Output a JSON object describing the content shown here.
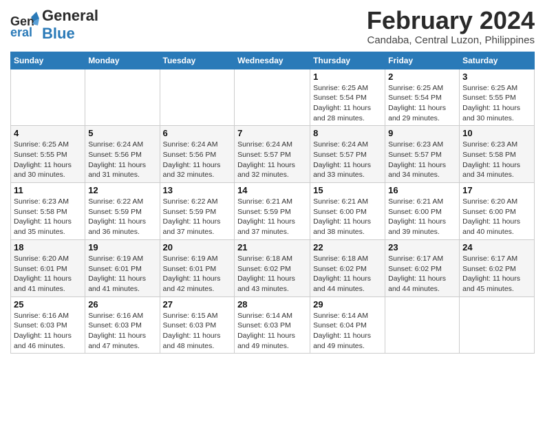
{
  "header": {
    "logo_general": "General",
    "logo_blue": "Blue",
    "month_title": "February 2024",
    "location": "Candaba, Central Luzon, Philippines"
  },
  "weekdays": [
    "Sunday",
    "Monday",
    "Tuesday",
    "Wednesday",
    "Thursday",
    "Friday",
    "Saturday"
  ],
  "weeks": [
    [
      {
        "num": "",
        "sunrise": "",
        "sunset": "",
        "daylight": ""
      },
      {
        "num": "",
        "sunrise": "",
        "sunset": "",
        "daylight": ""
      },
      {
        "num": "",
        "sunrise": "",
        "sunset": "",
        "daylight": ""
      },
      {
        "num": "",
        "sunrise": "",
        "sunset": "",
        "daylight": ""
      },
      {
        "num": "1",
        "sunrise": "Sunrise: 6:25 AM",
        "sunset": "Sunset: 5:54 PM",
        "daylight": "Daylight: 11 hours and 28 minutes."
      },
      {
        "num": "2",
        "sunrise": "Sunrise: 6:25 AM",
        "sunset": "Sunset: 5:54 PM",
        "daylight": "Daylight: 11 hours and 29 minutes."
      },
      {
        "num": "3",
        "sunrise": "Sunrise: 6:25 AM",
        "sunset": "Sunset: 5:55 PM",
        "daylight": "Daylight: 11 hours and 30 minutes."
      }
    ],
    [
      {
        "num": "4",
        "sunrise": "Sunrise: 6:25 AM",
        "sunset": "Sunset: 5:55 PM",
        "daylight": "Daylight: 11 hours and 30 minutes."
      },
      {
        "num": "5",
        "sunrise": "Sunrise: 6:24 AM",
        "sunset": "Sunset: 5:56 PM",
        "daylight": "Daylight: 11 hours and 31 minutes."
      },
      {
        "num": "6",
        "sunrise": "Sunrise: 6:24 AM",
        "sunset": "Sunset: 5:56 PM",
        "daylight": "Daylight: 11 hours and 32 minutes."
      },
      {
        "num": "7",
        "sunrise": "Sunrise: 6:24 AM",
        "sunset": "Sunset: 5:57 PM",
        "daylight": "Daylight: 11 hours and 32 minutes."
      },
      {
        "num": "8",
        "sunrise": "Sunrise: 6:24 AM",
        "sunset": "Sunset: 5:57 PM",
        "daylight": "Daylight: 11 hours and 33 minutes."
      },
      {
        "num": "9",
        "sunrise": "Sunrise: 6:23 AM",
        "sunset": "Sunset: 5:57 PM",
        "daylight": "Daylight: 11 hours and 34 minutes."
      },
      {
        "num": "10",
        "sunrise": "Sunrise: 6:23 AM",
        "sunset": "Sunset: 5:58 PM",
        "daylight": "Daylight: 11 hours and 34 minutes."
      }
    ],
    [
      {
        "num": "11",
        "sunrise": "Sunrise: 6:23 AM",
        "sunset": "Sunset: 5:58 PM",
        "daylight": "Daylight: 11 hours and 35 minutes."
      },
      {
        "num": "12",
        "sunrise": "Sunrise: 6:22 AM",
        "sunset": "Sunset: 5:59 PM",
        "daylight": "Daylight: 11 hours and 36 minutes."
      },
      {
        "num": "13",
        "sunrise": "Sunrise: 6:22 AM",
        "sunset": "Sunset: 5:59 PM",
        "daylight": "Daylight: 11 hours and 37 minutes."
      },
      {
        "num": "14",
        "sunrise": "Sunrise: 6:21 AM",
        "sunset": "Sunset: 5:59 PM",
        "daylight": "Daylight: 11 hours and 37 minutes."
      },
      {
        "num": "15",
        "sunrise": "Sunrise: 6:21 AM",
        "sunset": "Sunset: 6:00 PM",
        "daylight": "Daylight: 11 hours and 38 minutes."
      },
      {
        "num": "16",
        "sunrise": "Sunrise: 6:21 AM",
        "sunset": "Sunset: 6:00 PM",
        "daylight": "Daylight: 11 hours and 39 minutes."
      },
      {
        "num": "17",
        "sunrise": "Sunrise: 6:20 AM",
        "sunset": "Sunset: 6:00 PM",
        "daylight": "Daylight: 11 hours and 40 minutes."
      }
    ],
    [
      {
        "num": "18",
        "sunrise": "Sunrise: 6:20 AM",
        "sunset": "Sunset: 6:01 PM",
        "daylight": "Daylight: 11 hours and 41 minutes."
      },
      {
        "num": "19",
        "sunrise": "Sunrise: 6:19 AM",
        "sunset": "Sunset: 6:01 PM",
        "daylight": "Daylight: 11 hours and 41 minutes."
      },
      {
        "num": "20",
        "sunrise": "Sunrise: 6:19 AM",
        "sunset": "Sunset: 6:01 PM",
        "daylight": "Daylight: 11 hours and 42 minutes."
      },
      {
        "num": "21",
        "sunrise": "Sunrise: 6:18 AM",
        "sunset": "Sunset: 6:02 PM",
        "daylight": "Daylight: 11 hours and 43 minutes."
      },
      {
        "num": "22",
        "sunrise": "Sunrise: 6:18 AM",
        "sunset": "Sunset: 6:02 PM",
        "daylight": "Daylight: 11 hours and 44 minutes."
      },
      {
        "num": "23",
        "sunrise": "Sunrise: 6:17 AM",
        "sunset": "Sunset: 6:02 PM",
        "daylight": "Daylight: 11 hours and 44 minutes."
      },
      {
        "num": "24",
        "sunrise": "Sunrise: 6:17 AM",
        "sunset": "Sunset: 6:02 PM",
        "daylight": "Daylight: 11 hours and 45 minutes."
      }
    ],
    [
      {
        "num": "25",
        "sunrise": "Sunrise: 6:16 AM",
        "sunset": "Sunset: 6:03 PM",
        "daylight": "Daylight: 11 hours and 46 minutes."
      },
      {
        "num": "26",
        "sunrise": "Sunrise: 6:16 AM",
        "sunset": "Sunset: 6:03 PM",
        "daylight": "Daylight: 11 hours and 47 minutes."
      },
      {
        "num": "27",
        "sunrise": "Sunrise: 6:15 AM",
        "sunset": "Sunset: 6:03 PM",
        "daylight": "Daylight: 11 hours and 48 minutes."
      },
      {
        "num": "28",
        "sunrise": "Sunrise: 6:14 AM",
        "sunset": "Sunset: 6:03 PM",
        "daylight": "Daylight: 11 hours and 49 minutes."
      },
      {
        "num": "29",
        "sunrise": "Sunrise: 6:14 AM",
        "sunset": "Sunset: 6:04 PM",
        "daylight": "Daylight: 11 hours and 49 minutes."
      },
      {
        "num": "",
        "sunrise": "",
        "sunset": "",
        "daylight": ""
      },
      {
        "num": "",
        "sunrise": "",
        "sunset": "",
        "daylight": ""
      }
    ]
  ]
}
